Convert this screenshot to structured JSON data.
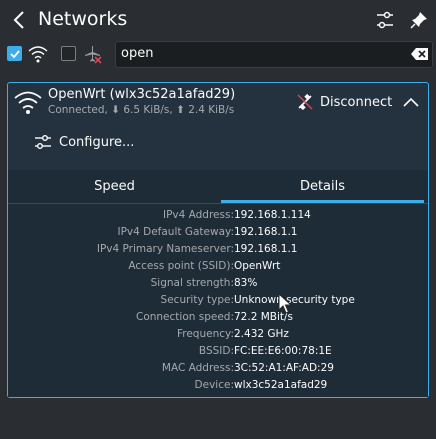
{
  "header": {
    "title": "Networks"
  },
  "filters": {
    "wifi_enabled": true,
    "airplane_mode": false
  },
  "search": {
    "value": "open"
  },
  "network": {
    "name": "OpenWrt (wlx3c52a1afad29)",
    "status": "Connected, ⬇ 6.5 KiB/s, ⬆ 2.4 KiB/s",
    "disconnect_label": "Disconnect",
    "configure_label": "Configure...",
    "tabs": [
      "Speed",
      "Details"
    ],
    "active_tab": "Details",
    "details": [
      {
        "label": "IPv4 Address:",
        "value": "192.168.1.114"
      },
      {
        "label": "IPv4 Default Gateway:",
        "value": "192.168.1.1"
      },
      {
        "label": "IPv4 Primary Nameserver:",
        "value": "192.168.1.1"
      },
      {
        "label": "Access point (SSID):",
        "value": "OpenWrt"
      },
      {
        "label": "Signal strength:",
        "value": "83%"
      },
      {
        "label": "Security type:",
        "value": "Unknown security type"
      },
      {
        "label": "Connection speed:",
        "value": "72.2 MBit/s"
      },
      {
        "label": "Frequency:",
        "value": "2.432 GHz"
      },
      {
        "label": "BSSID:",
        "value": "FC:EE:E6:00:78:1E"
      },
      {
        "label": "MAC Address:",
        "value": "3C:52:A1:AF:AD:29"
      },
      {
        "label": "Device:",
        "value": "wlx3c52a1afad29"
      }
    ]
  },
  "colors": {
    "accent": "#3daee9",
    "background": "#2a2e32",
    "card": "#243240"
  }
}
